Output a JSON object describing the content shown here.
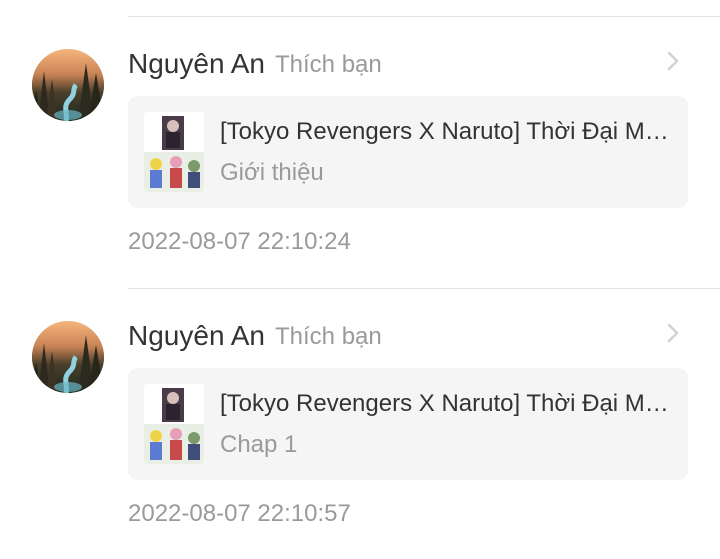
{
  "notifications": [
    {
      "user_name": "Nguyên An",
      "action": "Thích bạn",
      "avatar_icon": "forest-landscape-avatar",
      "chevron_icon": "chevron-right-icon",
      "card": {
        "title": "[Tokyo Revengers X Naruto] Thời Đại Mới…",
        "subtitle": "Giới thiệu",
        "thumbnail_icon": "story-cover-thumbnail"
      },
      "timestamp": "2022-08-07 22:10:24"
    },
    {
      "user_name": "Nguyên An",
      "action": "Thích bạn",
      "avatar_icon": "forest-landscape-avatar",
      "chevron_icon": "chevron-right-icon",
      "card": {
        "title": "[Tokyo Revengers X Naruto] Thời Đại Mới…",
        "subtitle": "Chap 1",
        "thumbnail_icon": "story-cover-thumbnail"
      },
      "timestamp": "2022-08-07 22:10:57"
    }
  ],
  "colors": {
    "background": "#ffffff",
    "card_background": "#f5f5f5",
    "primary_text": "#333333",
    "secondary_text": "#9a9a9a",
    "divider": "#e3e3e3"
  }
}
